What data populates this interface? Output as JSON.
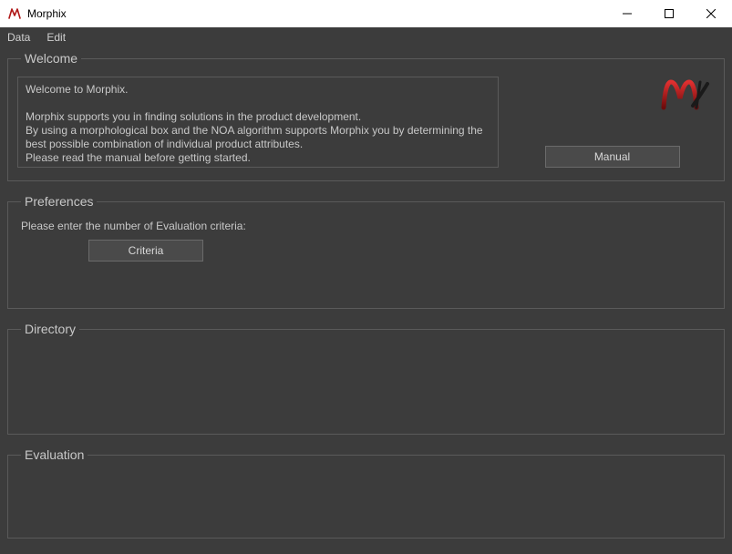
{
  "window": {
    "title": "Morphix"
  },
  "menu": {
    "data": "Data",
    "edit": "Edit"
  },
  "groups": {
    "welcome_legend": "Welcome",
    "preferences_legend": "Preferences",
    "directory_legend": "Directory",
    "evaluation_legend": "Evaluation"
  },
  "welcome": {
    "line1": "Welcome to Morphix.",
    "line2": "Morphix supports you in finding solutions in the product development.",
    "line3": "By using a morphological box and the NOA algorithm supports Morphix you by determining the best possible combination of individual product attributes.",
    "line4": "Please read the manual before getting started.",
    "manual_button": "Manual"
  },
  "preferences": {
    "prompt": "Please enter the number of Evaluation criteria:",
    "criteria_button": "Criteria"
  }
}
